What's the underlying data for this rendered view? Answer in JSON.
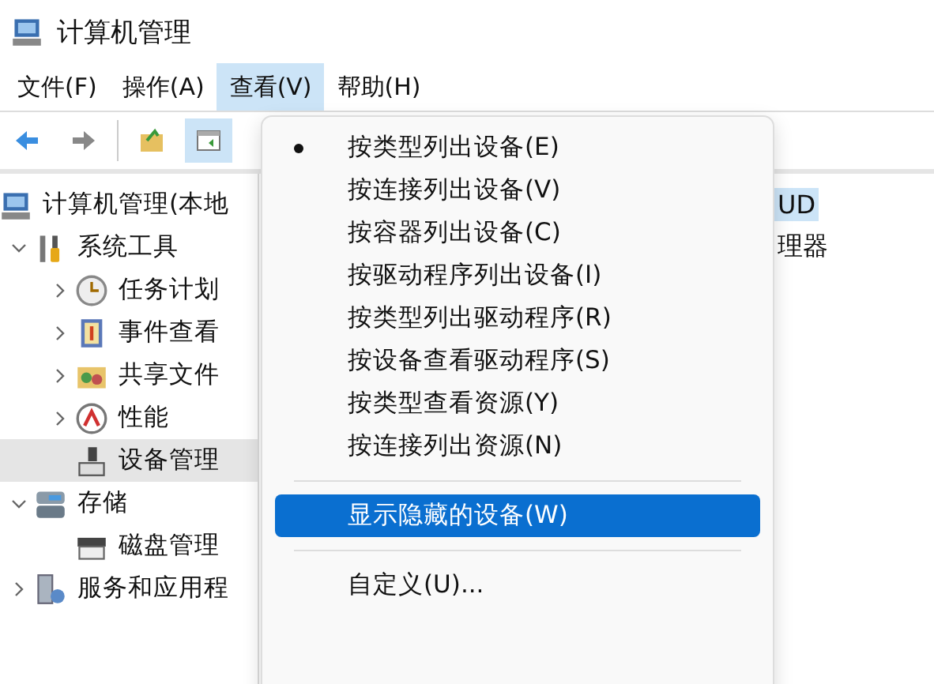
{
  "window": {
    "title": "计算机管理"
  },
  "menubar": [
    {
      "label": "文件(F)",
      "selected": false
    },
    {
      "label": "操作(A)",
      "selected": false
    },
    {
      "label": "查看(V)",
      "selected": true
    },
    {
      "label": "帮助(H)",
      "selected": false
    }
  ],
  "toolbar": {
    "buttons": [
      {
        "selected": false
      },
      {
        "selected": false
      },
      {
        "selected": false
      },
      {
        "selected": true
      }
    ]
  },
  "tree": [
    {
      "label": "计算机管理(本地",
      "children": [
        {
          "label": "系统工具",
          "expanded": true,
          "children": [
            {
              "label": "任务计划",
              "expanded": false,
              "selected": false
            },
            {
              "label": "事件查看",
              "expanded": false,
              "selected": false
            },
            {
              "label": "共享文件",
              "expanded": false,
              "selected": false
            },
            {
              "label": "性能",
              "expanded": false,
              "selected": false
            },
            {
              "label": "设备管理",
              "selected": true
            }
          ]
        },
        {
          "label": "存储",
          "expanded": true,
          "children": [
            {
              "label": "磁盘管理",
              "selected": false
            }
          ]
        },
        {
          "label": "服务和应用程",
          "expanded": false,
          "selected": false
        }
      ]
    }
  ],
  "content": {
    "rows": [
      {
        "text": "UD",
        "selected": true
      },
      {
        "text": "理器",
        "selected": false
      }
    ]
  },
  "view_menu": [
    {
      "kind": "radio",
      "label": "按类型列出设备(E)",
      "checked": true,
      "selected": false
    },
    {
      "kind": "radio",
      "label": "按连接列出设备(V)",
      "checked": false,
      "selected": false
    },
    {
      "kind": "radio",
      "label": "按容器列出设备(C)",
      "checked": false,
      "selected": false
    },
    {
      "kind": "radio",
      "label": "按驱动程序列出设备(I)",
      "checked": false,
      "selected": false
    },
    {
      "kind": "radio",
      "label": "按类型列出驱动程序(R)",
      "checked": false,
      "selected": false
    },
    {
      "kind": "radio",
      "label": "按设备查看驱动程序(S)",
      "checked": false,
      "selected": false
    },
    {
      "kind": "radio",
      "label": "按类型查看资源(Y)",
      "checked": false,
      "selected": false
    },
    {
      "kind": "radio",
      "label": "按连接列出资源(N)",
      "checked": false,
      "selected": false
    },
    {
      "kind": "separator"
    },
    {
      "kind": "command",
      "label": "显示隐藏的设备(W)",
      "selected": true
    },
    {
      "kind": "separator"
    },
    {
      "kind": "command",
      "label": "自定义(U)...",
      "selected": false
    }
  ]
}
